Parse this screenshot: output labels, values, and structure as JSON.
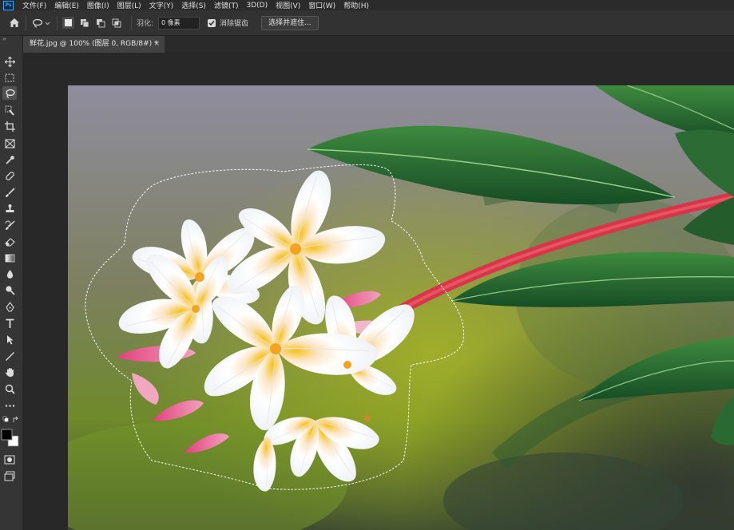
{
  "app": {
    "logo_text": "Ps"
  },
  "menu": [
    "文件(F)",
    "编辑(E)",
    "图像(I)",
    "图层(L)",
    "文字(Y)",
    "选择(S)",
    "滤镜(T)",
    "3D(D)",
    "视图(V)",
    "窗口(W)",
    "帮助(H)"
  ],
  "options": {
    "feather_label": "羽化:",
    "feather_value": "0 像素",
    "antialias_label": "消除锯齿",
    "antialias_checked": true,
    "select_mask_label": "选择并遮住..."
  },
  "document": {
    "tab_title": "鲜花.jpg @ 100% (图层 0, RGB/8#) *",
    "close_glyph": "×"
  },
  "toolbar": {
    "collapse_glyph": "»",
    "tools": [
      "move-icon",
      "marquee-icon",
      "lasso-icon",
      "quick-select-icon",
      "crop-icon",
      "frame-icon",
      "eyedropper-icon",
      "healing-brush-icon",
      "brush-icon",
      "clone-stamp-icon",
      "history-brush-icon",
      "eraser-icon",
      "gradient-icon",
      "blur-icon",
      "dodge-icon",
      "pen-icon",
      "type-icon",
      "path-select-icon",
      "line-icon",
      "hand-icon",
      "zoom-icon",
      "more-tools-icon"
    ],
    "active_tool": "lasso-icon",
    "foreground_color": "#000000",
    "background_color": "#ffffff"
  },
  "colors": {
    "menubar_bg": "#2b2b2b",
    "optionsbar_bg": "#323232",
    "toolbar_bg": "#353535",
    "canvas_bg": "#282828",
    "accent": "#31a8ff"
  }
}
